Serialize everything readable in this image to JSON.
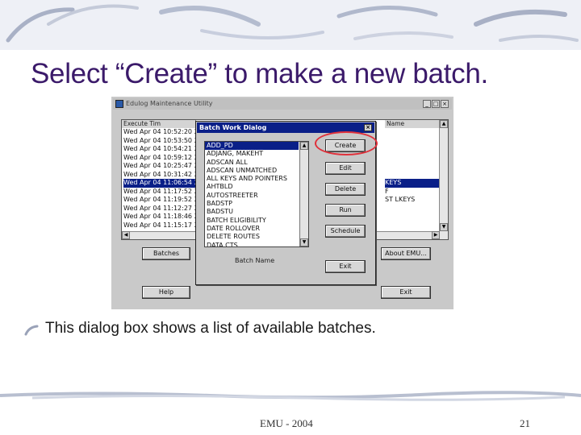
{
  "slide": {
    "title": "Select “Create” to make a new batch.",
    "bullet": "This dialog box shows a list of available batches.",
    "footer_center": "EMU - 2004",
    "page_number": "21"
  },
  "main_window": {
    "title": "Edulog Maintenance Utility",
    "window_buttons": [
      "_",
      "□",
      "×"
    ],
    "columns": [
      "Execute Tim",
      "Name"
    ],
    "rows": [
      "Wed Apr 04 10:52:20 2",
      "Wed Apr 04 10:53:50 2",
      "Wed Apr 04 10:54:21 2",
      "Wed Apr 04 10:59:12 2",
      "Wed Apr 04 10:25:47 2",
      "Wed Apr 04 10:31:42 2",
      "Wed Apr 04 11:06:54 2",
      "Wed Apr 04 11:17:52 2",
      "Wed Apr 04 11:19:52 2",
      "Wed Apr 04 11:12:27 2",
      "Wed Apr 04 11:18:46 2",
      "Wed Apr 04 11:15:17 2"
    ],
    "selected_row": 6,
    "right_rows": [
      "",
      "",
      "",
      "",
      "",
      "",
      "KEYS",
      "F",
      "ST LKEYS",
      "",
      "",
      ""
    ],
    "buttons": {
      "batches": "Batches",
      "about": "About EMU...",
      "help": "Help",
      "exit": "Exit"
    }
  },
  "dialog": {
    "title": "Batch Work Dialog",
    "close": "×",
    "batches": [
      "ADD_PD",
      "ADJANG, MAKEHT",
      "ADSCAN ALL",
      "ADSCAN UNMATCHED",
      "ALL KEYS AND POINTERS",
      "AHTBLD",
      "AUTOSTREETER",
      "BADSTP",
      "BADSTU",
      "BATCH ELIGIBILITY",
      "DATE ROLLOVER",
      "DELETE ROUTES",
      "DATA CTS"
    ],
    "selected_index": 0,
    "batch_name_label": "Batch Name",
    "buttons": {
      "create": "Create",
      "edit": "Edit",
      "delete": "Delete",
      "run": "Run",
      "schedule": "Schedule",
      "exit": "Exit"
    }
  },
  "colors": {
    "title_text": "#3b1a6a",
    "highlight_ring": "#e0303a",
    "selection": "#0a1f88",
    "dialog_title_bar": "#0a1f88"
  }
}
